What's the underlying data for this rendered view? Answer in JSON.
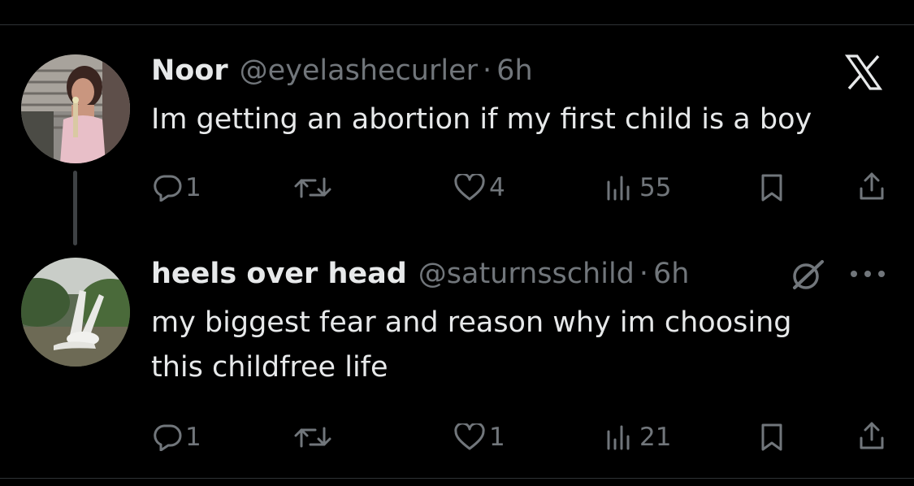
{
  "colors": {
    "background": "#000000",
    "primary_text": "#e7e9ea",
    "secondary_text": "#71767b",
    "divider": "#2f3336"
  },
  "tweets": [
    {
      "display_name": "Noor",
      "handle": "@eyelashecurler",
      "separator": "·",
      "time": "6h",
      "text": "Im getting an abortion if my first child is a boy",
      "top_right_icon": "x-logo-icon",
      "actions": {
        "reply_count": "1",
        "retweet_count": "",
        "like_count": "4",
        "views_count": "55"
      }
    },
    {
      "display_name": "heels over head",
      "handle": "@saturnsschild",
      "separator": "·",
      "time": "6h",
      "text": "my biggest fear and reason why im choosing\nthis childfree life",
      "top_right_icons": [
        "grok-icon",
        "more-icon"
      ],
      "actions": {
        "reply_count": "1",
        "retweet_count": "",
        "like_count": "1",
        "views_count": "21"
      }
    }
  ]
}
